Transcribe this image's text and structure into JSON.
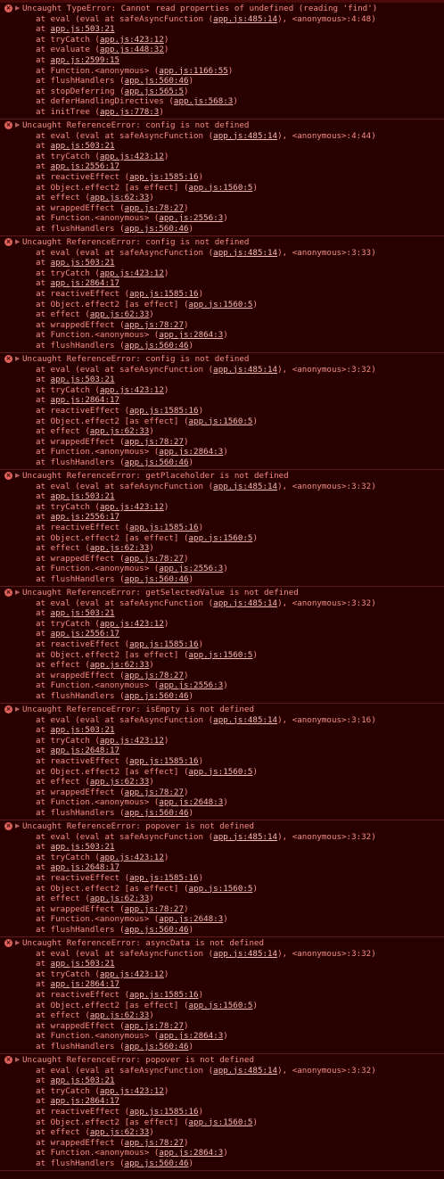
{
  "errors": [
    {
      "message": "Uncaught TypeError: Cannot read properties of undefined (reading 'find')",
      "frames": [
        {
          "fn": "eval (eval at safeAsyncFunction",
          "loc": "app.js:485:14",
          "tail": "), <anonymous>:4:48)"
        },
        {
          "fn": "",
          "loc": "app.js:503:21",
          "tail": ""
        },
        {
          "fn": "tryCatch",
          "loc": "app.js:423:12",
          "tail": ""
        },
        {
          "fn": "evaluate",
          "loc": "app.js:448:32",
          "tail": ""
        },
        {
          "fn": "",
          "loc": "app.js:2599:15",
          "tail": ""
        },
        {
          "fn": "Function.<anonymous>",
          "loc": "app.js:1166:55",
          "tail": ""
        },
        {
          "fn": "flushHandlers",
          "loc": "app.js:560:46",
          "tail": ""
        },
        {
          "fn": "stopDeferring",
          "loc": "app.js:565:5",
          "tail": ""
        },
        {
          "fn": "deferHandlingDirectives",
          "loc": "app.js:568:3",
          "tail": ""
        },
        {
          "fn": "initTree",
          "loc": "app.js:778:3",
          "tail": ""
        }
      ]
    },
    {
      "message": "Uncaught ReferenceError: config is not defined",
      "frames": [
        {
          "fn": "eval (eval at safeAsyncFunction",
          "loc": "app.js:485:14",
          "tail": "), <anonymous>:4:44)"
        },
        {
          "fn": "",
          "loc": "app.js:503:21",
          "tail": ""
        },
        {
          "fn": "tryCatch",
          "loc": "app.js:423:12",
          "tail": ""
        },
        {
          "fn": "",
          "loc": "app.js:2556:17",
          "tail": ""
        },
        {
          "fn": "reactiveEffect",
          "loc": "app.js:1585:16",
          "tail": ""
        },
        {
          "fn": "Object.effect2 [as effect]",
          "loc": "app.js:1560:5",
          "tail": ""
        },
        {
          "fn": "effect",
          "loc": "app.js:62:33",
          "tail": ""
        },
        {
          "fn": "wrappedEffect",
          "loc": "app.js:78:27",
          "tail": ""
        },
        {
          "fn": "Function.<anonymous>",
          "loc": "app.js:2556:3",
          "tail": ""
        },
        {
          "fn": "flushHandlers",
          "loc": "app.js:560:46",
          "tail": ""
        }
      ]
    },
    {
      "message": "Uncaught ReferenceError: config is not defined",
      "frames": [
        {
          "fn": "eval (eval at safeAsyncFunction",
          "loc": "app.js:485:14",
          "tail": "), <anonymous>:3:33)"
        },
        {
          "fn": "",
          "loc": "app.js:503:21",
          "tail": ""
        },
        {
          "fn": "tryCatch",
          "loc": "app.js:423:12",
          "tail": ""
        },
        {
          "fn": "",
          "loc": "app.js:2864:17",
          "tail": ""
        },
        {
          "fn": "reactiveEffect",
          "loc": "app.js:1585:16",
          "tail": ""
        },
        {
          "fn": "Object.effect2 [as effect]",
          "loc": "app.js:1560:5",
          "tail": ""
        },
        {
          "fn": "effect",
          "loc": "app.js:62:33",
          "tail": ""
        },
        {
          "fn": "wrappedEffect",
          "loc": "app.js:78:27",
          "tail": ""
        },
        {
          "fn": "Function.<anonymous>",
          "loc": "app.js:2864:3",
          "tail": ""
        },
        {
          "fn": "flushHandlers",
          "loc": "app.js:560:46",
          "tail": ""
        }
      ]
    },
    {
      "message": "Uncaught ReferenceError: config is not defined",
      "frames": [
        {
          "fn": "eval (eval at safeAsyncFunction",
          "loc": "app.js:485:14",
          "tail": "), <anonymous>:3:32)"
        },
        {
          "fn": "",
          "loc": "app.js:503:21",
          "tail": ""
        },
        {
          "fn": "tryCatch",
          "loc": "app.js:423:12",
          "tail": ""
        },
        {
          "fn": "",
          "loc": "app.js:2864:17",
          "tail": ""
        },
        {
          "fn": "reactiveEffect",
          "loc": "app.js:1585:16",
          "tail": ""
        },
        {
          "fn": "Object.effect2 [as effect]",
          "loc": "app.js:1560:5",
          "tail": ""
        },
        {
          "fn": "effect",
          "loc": "app.js:62:33",
          "tail": ""
        },
        {
          "fn": "wrappedEffect",
          "loc": "app.js:78:27",
          "tail": ""
        },
        {
          "fn": "Function.<anonymous>",
          "loc": "app.js:2864:3",
          "tail": ""
        },
        {
          "fn": "flushHandlers",
          "loc": "app.js:560:46",
          "tail": ""
        }
      ]
    },
    {
      "message": "Uncaught ReferenceError: getPlaceholder is not defined",
      "frames": [
        {
          "fn": "eval (eval at safeAsyncFunction",
          "loc": "app.js:485:14",
          "tail": "), <anonymous>:3:32)"
        },
        {
          "fn": "",
          "loc": "app.js:503:21",
          "tail": ""
        },
        {
          "fn": "tryCatch",
          "loc": "app.js:423:12",
          "tail": ""
        },
        {
          "fn": "",
          "loc": "app.js:2556:17",
          "tail": ""
        },
        {
          "fn": "reactiveEffect",
          "loc": "app.js:1585:16",
          "tail": ""
        },
        {
          "fn": "Object.effect2 [as effect]",
          "loc": "app.js:1560:5",
          "tail": ""
        },
        {
          "fn": "effect",
          "loc": "app.js:62:33",
          "tail": ""
        },
        {
          "fn": "wrappedEffect",
          "loc": "app.js:78:27",
          "tail": ""
        },
        {
          "fn": "Function.<anonymous>",
          "loc": "app.js:2556:3",
          "tail": ""
        },
        {
          "fn": "flushHandlers",
          "loc": "app.js:560:46",
          "tail": ""
        }
      ]
    },
    {
      "message": "Uncaught ReferenceError: getSelectedValue is not defined",
      "frames": [
        {
          "fn": "eval (eval at safeAsyncFunction",
          "loc": "app.js:485:14",
          "tail": "), <anonymous>:3:32)"
        },
        {
          "fn": "",
          "loc": "app.js:503:21",
          "tail": ""
        },
        {
          "fn": "tryCatch",
          "loc": "app.js:423:12",
          "tail": ""
        },
        {
          "fn": "",
          "loc": "app.js:2556:17",
          "tail": ""
        },
        {
          "fn": "reactiveEffect",
          "loc": "app.js:1585:16",
          "tail": ""
        },
        {
          "fn": "Object.effect2 [as effect]",
          "loc": "app.js:1560:5",
          "tail": ""
        },
        {
          "fn": "effect",
          "loc": "app.js:62:33",
          "tail": ""
        },
        {
          "fn": "wrappedEffect",
          "loc": "app.js:78:27",
          "tail": ""
        },
        {
          "fn": "Function.<anonymous>",
          "loc": "app.js:2556:3",
          "tail": ""
        },
        {
          "fn": "flushHandlers",
          "loc": "app.js:560:46",
          "tail": ""
        }
      ]
    },
    {
      "message": "Uncaught ReferenceError: isEmpty is not defined",
      "frames": [
        {
          "fn": "eval (eval at safeAsyncFunction",
          "loc": "app.js:485:14",
          "tail": "), <anonymous>:3:16)"
        },
        {
          "fn": "",
          "loc": "app.js:503:21",
          "tail": ""
        },
        {
          "fn": "tryCatch",
          "loc": "app.js:423:12",
          "tail": ""
        },
        {
          "fn": "",
          "loc": "app.js:2648:17",
          "tail": ""
        },
        {
          "fn": "reactiveEffect",
          "loc": "app.js:1585:16",
          "tail": ""
        },
        {
          "fn": "Object.effect2 [as effect]",
          "loc": "app.js:1560:5",
          "tail": ""
        },
        {
          "fn": "effect",
          "loc": "app.js:62:33",
          "tail": ""
        },
        {
          "fn": "wrappedEffect",
          "loc": "app.js:78:27",
          "tail": ""
        },
        {
          "fn": "Function.<anonymous>",
          "loc": "app.js:2648:3",
          "tail": ""
        },
        {
          "fn": "flushHandlers",
          "loc": "app.js:560:46",
          "tail": ""
        }
      ]
    },
    {
      "message": "Uncaught ReferenceError: popover is not defined",
      "frames": [
        {
          "fn": "eval (eval at safeAsyncFunction",
          "loc": "app.js:485:14",
          "tail": "), <anonymous>:3:32)"
        },
        {
          "fn": "",
          "loc": "app.js:503:21",
          "tail": ""
        },
        {
          "fn": "tryCatch",
          "loc": "app.js:423:12",
          "tail": ""
        },
        {
          "fn": "",
          "loc": "app.js:2648:17",
          "tail": ""
        },
        {
          "fn": "reactiveEffect",
          "loc": "app.js:1585:16",
          "tail": ""
        },
        {
          "fn": "Object.effect2 [as effect]",
          "loc": "app.js:1560:5",
          "tail": ""
        },
        {
          "fn": "effect",
          "loc": "app.js:62:33",
          "tail": ""
        },
        {
          "fn": "wrappedEffect",
          "loc": "app.js:78:27",
          "tail": ""
        },
        {
          "fn": "Function.<anonymous>",
          "loc": "app.js:2648:3",
          "tail": ""
        },
        {
          "fn": "flushHandlers",
          "loc": "app.js:560:46",
          "tail": ""
        }
      ]
    },
    {
      "message": "Uncaught ReferenceError: asyncData is not defined",
      "frames": [
        {
          "fn": "eval (eval at safeAsyncFunction",
          "loc": "app.js:485:14",
          "tail": "), <anonymous>:3:32)"
        },
        {
          "fn": "",
          "loc": "app.js:503:21",
          "tail": ""
        },
        {
          "fn": "tryCatch",
          "loc": "app.js:423:12",
          "tail": ""
        },
        {
          "fn": "",
          "loc": "app.js:2864:17",
          "tail": ""
        },
        {
          "fn": "reactiveEffect",
          "loc": "app.js:1585:16",
          "tail": ""
        },
        {
          "fn": "Object.effect2 [as effect]",
          "loc": "app.js:1560:5",
          "tail": ""
        },
        {
          "fn": "effect",
          "loc": "app.js:62:33",
          "tail": ""
        },
        {
          "fn": "wrappedEffect",
          "loc": "app.js:78:27",
          "tail": ""
        },
        {
          "fn": "Function.<anonymous>",
          "loc": "app.js:2864:3",
          "tail": ""
        },
        {
          "fn": "flushHandlers",
          "loc": "app.js:560:46",
          "tail": ""
        }
      ]
    },
    {
      "message": "Uncaught ReferenceError: popover is not defined",
      "frames": [
        {
          "fn": "eval (eval at safeAsyncFunction",
          "loc": "app.js:485:14",
          "tail": "), <anonymous>:3:32)"
        },
        {
          "fn": "",
          "loc": "app.js:503:21",
          "tail": ""
        },
        {
          "fn": "tryCatch",
          "loc": "app.js:423:12",
          "tail": ""
        },
        {
          "fn": "",
          "loc": "app.js:2864:17",
          "tail": ""
        },
        {
          "fn": "reactiveEffect",
          "loc": "app.js:1585:16",
          "tail": ""
        },
        {
          "fn": "Object.effect2 [as effect]",
          "loc": "app.js:1560:5",
          "tail": ""
        },
        {
          "fn": "effect",
          "loc": "app.js:62:33",
          "tail": ""
        },
        {
          "fn": "wrappedEffect",
          "loc": "app.js:78:27",
          "tail": ""
        },
        {
          "fn": "Function.<anonymous>",
          "loc": "app.js:2864:3",
          "tail": ""
        },
        {
          "fn": "flushHandlers",
          "loc": "app.js:560:46",
          "tail": ""
        }
      ]
    }
  ],
  "icons": {
    "error": "error-circle-icon",
    "expand": "triangle-right-icon"
  },
  "colors": {
    "background": "#290000",
    "text": "#f28b82",
    "link": "#f6b8b2",
    "divider": "#5c1a1a",
    "error_icon": "#e0605a"
  }
}
